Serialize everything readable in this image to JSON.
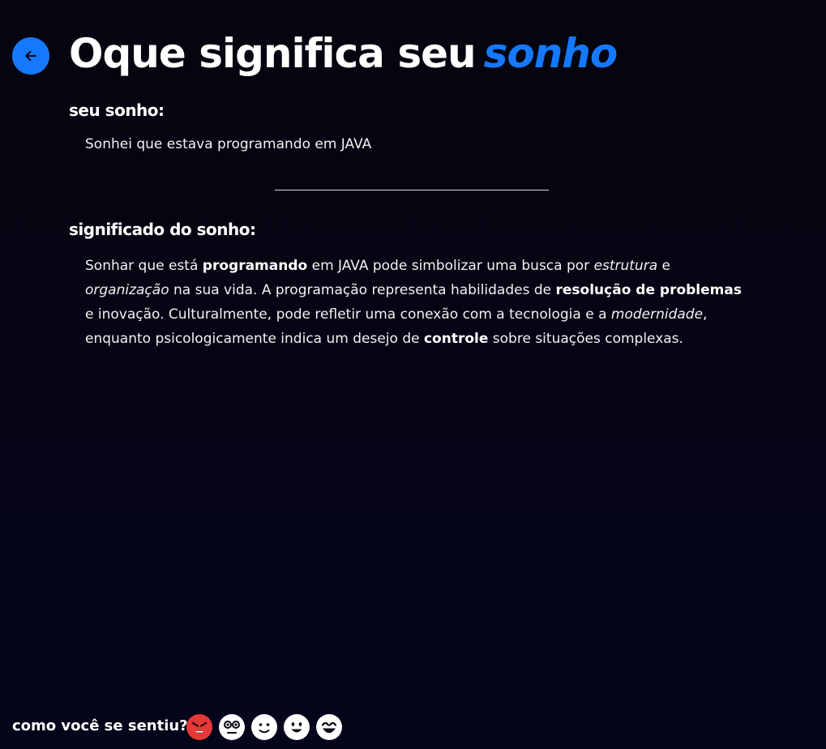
{
  "header": {
    "title_main": "Oque significa seu",
    "title_accent": "sonho",
    "back_icon": "arrow-left-icon"
  },
  "dream": {
    "heading": "seu sonho:",
    "text": "Sonhei que estava programando em JAVA"
  },
  "meaning": {
    "heading": "significado do sonho:",
    "parts": [
      "Sonhar que está ",
      "programando",
      " em JAVA pode simbolizar uma busca por ",
      "estrutura",
      " e ",
      "organização",
      " na sua vida. A programação representa habilidades de ",
      "resolução de problemas",
      " e inovação. Culturalmente, pode refletir uma conexão com a tecnologia e a ",
      "modernidade",
      ", enquanto psicologicamente indica um desejo de ",
      "controle",
      " sobre situações complexas."
    ]
  },
  "feedback": {
    "label": "como você se sentiu?",
    "emojis": [
      "angry-face-icon",
      "shocked-face-icon",
      "slight-smile-icon",
      "smile-icon",
      "big-smile-icon"
    ]
  },
  "colors": {
    "accent": "#1479ff",
    "background": "#05050f",
    "angry": "#e53935",
    "emoji_face": "#ffffff"
  }
}
